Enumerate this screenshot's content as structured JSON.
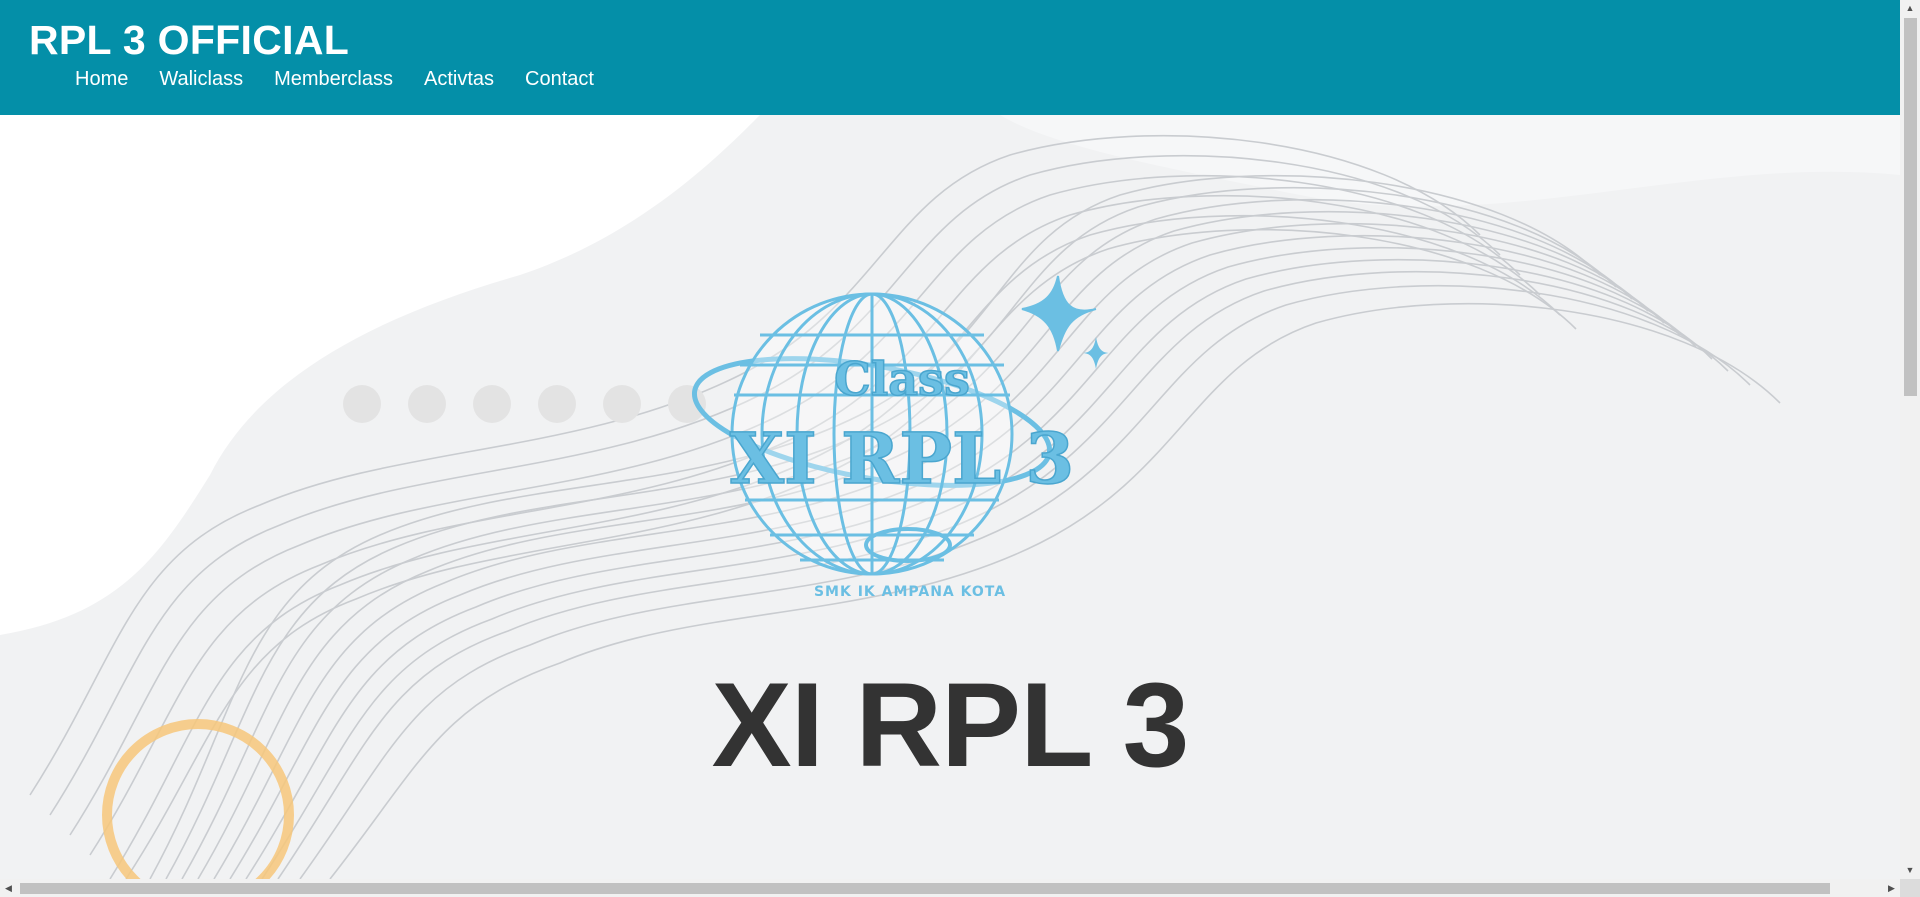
{
  "header": {
    "brand": "RPL 3 OFFICIAL",
    "nav": [
      "Home",
      "Waliclass",
      "Memberclass",
      "Activtas",
      "Contact"
    ]
  },
  "hero": {
    "title": "XI RPL 3",
    "logo": {
      "word_top": "Class",
      "word_main": "XI RPL 3",
      "school": "SMK IK AMPANA KOTA"
    }
  },
  "colors": {
    "header_bg": "#048fa8",
    "logo_blue": "#6bbfe3",
    "title_text": "#333333",
    "ring_orange": "#f7c77a"
  },
  "icons": {
    "scroll_up": "arrow-up-icon",
    "scroll_down": "arrow-down-icon",
    "scroll_left": "arrow-left-icon",
    "scroll_right": "arrow-right-icon"
  }
}
